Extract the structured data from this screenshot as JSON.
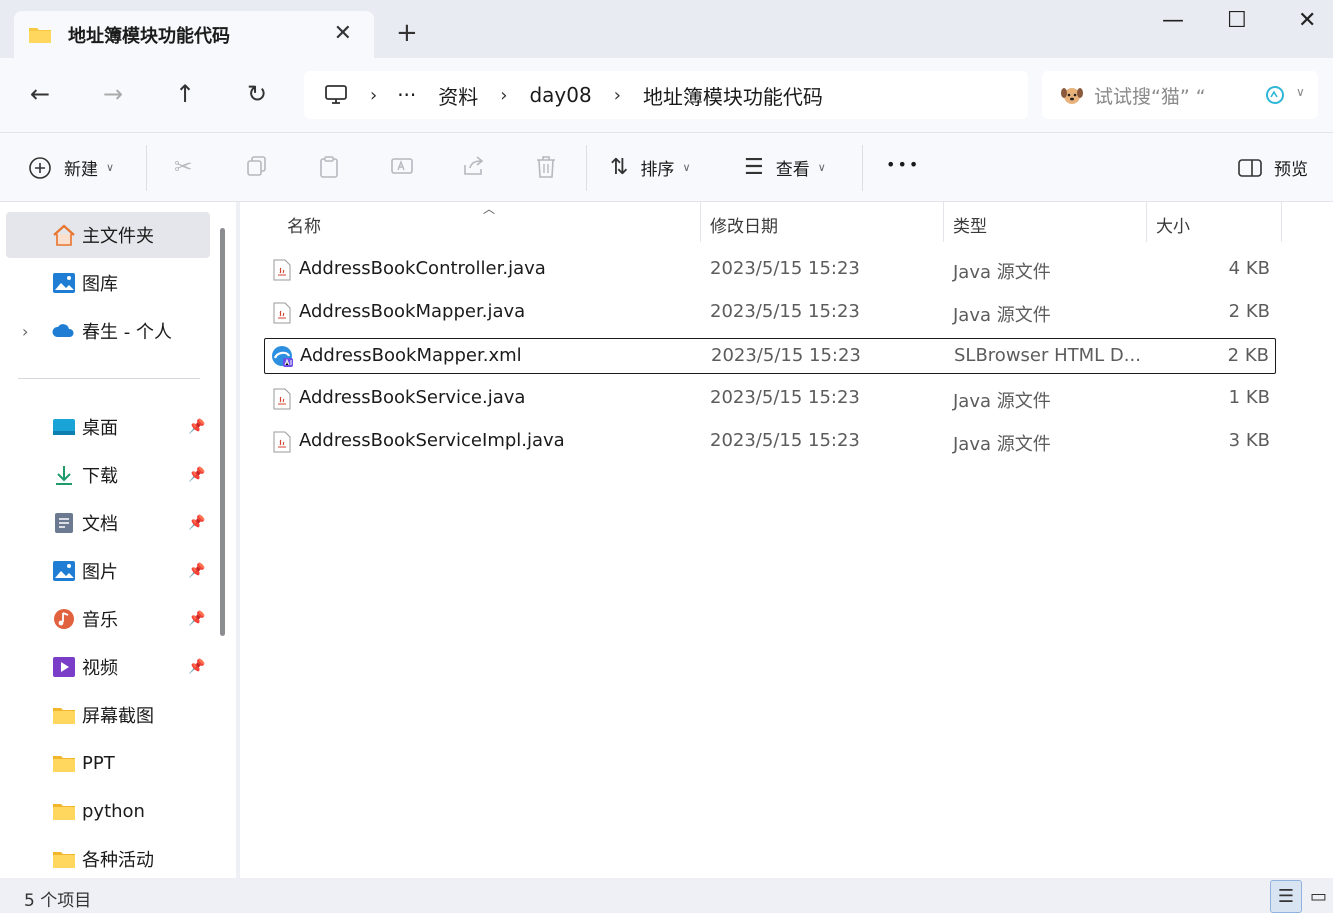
{
  "window": {
    "tab_title": "地址簿模块功能代码",
    "close_tab_glyph": "✕",
    "new_tab_glyph": "+",
    "minimize_glyph": "—",
    "maximize_glyph": "☐",
    "close_glyph": "✕"
  },
  "nav": {
    "back_glyph": "←",
    "forward_glyph": "→",
    "up_glyph": "↑",
    "refresh_glyph": "↻",
    "breadcrumb": {
      "more": "···",
      "segments": [
        "资料",
        "day08",
        "地址簿模块功能代码"
      ]
    },
    "search": {
      "placeholder": "试试搜“猫” “"
    }
  },
  "toolbar": {
    "new_label": "新建",
    "sort_label": "排序",
    "view_label": "查看",
    "more_glyph": "•••",
    "preview_label": "预览",
    "icons": [
      "cut-icon",
      "copy-icon",
      "paste-icon",
      "rename-icon",
      "share-icon",
      "delete-icon"
    ]
  },
  "sidebar": {
    "top_items": [
      {
        "label": "主文件夹",
        "icon": "home-icon",
        "selected": true
      },
      {
        "label": "图库",
        "icon": "gallery-icon"
      },
      {
        "label": "春生 - 个人",
        "icon": "onedrive-icon"
      }
    ],
    "quick_access": [
      {
        "label": "桌面",
        "icon": "desktop-icon",
        "pinned": true
      },
      {
        "label": "下载",
        "icon": "download-icon",
        "pinned": true
      },
      {
        "label": "文档",
        "icon": "documents-icon",
        "pinned": true
      },
      {
        "label": "图片",
        "icon": "pictures-icon",
        "pinned": true
      },
      {
        "label": "音乐",
        "icon": "music-icon",
        "pinned": true
      },
      {
        "label": "视频",
        "icon": "videos-icon",
        "pinned": true
      },
      {
        "label": "屏幕截图",
        "icon": "folder-icon"
      },
      {
        "label": "PPT",
        "icon": "folder-icon"
      },
      {
        "label": "python",
        "icon": "folder-icon"
      },
      {
        "label": "各种活动",
        "icon": "folder-icon"
      }
    ],
    "pin_glyph": "📌"
  },
  "list": {
    "columns": [
      "名称",
      "修改日期",
      "类型",
      "大小"
    ],
    "rows": [
      {
        "name": "AddressBookController.java",
        "date": "2023/5/15 15:23",
        "type": "Java 源文件",
        "size": "4 KB",
        "icon": "java-file-icon"
      },
      {
        "name": "AddressBookMapper.java",
        "date": "2023/5/15 15:23",
        "type": "Java 源文件",
        "size": "2 KB",
        "icon": "java-file-icon"
      },
      {
        "name": "AddressBookMapper.xml",
        "date": "2023/5/15 15:23",
        "type": "SLBrowser HTML D...",
        "size": "2 KB",
        "icon": "browser-file-icon",
        "focused": true
      },
      {
        "name": "AddressBookService.java",
        "date": "2023/5/15 15:23",
        "type": "Java 源文件",
        "size": "1 KB",
        "icon": "java-file-icon"
      },
      {
        "name": "AddressBookServiceImpl.java",
        "date": "2023/5/15 15:23",
        "type": "Java 源文件",
        "size": "3 KB",
        "icon": "java-file-icon"
      }
    ]
  },
  "status": {
    "item_count": "5 个项目"
  },
  "colors": {
    "accent": "#0067c0",
    "folder_yellow": "#f6c944",
    "selected_bg": "#e4e6eb"
  }
}
